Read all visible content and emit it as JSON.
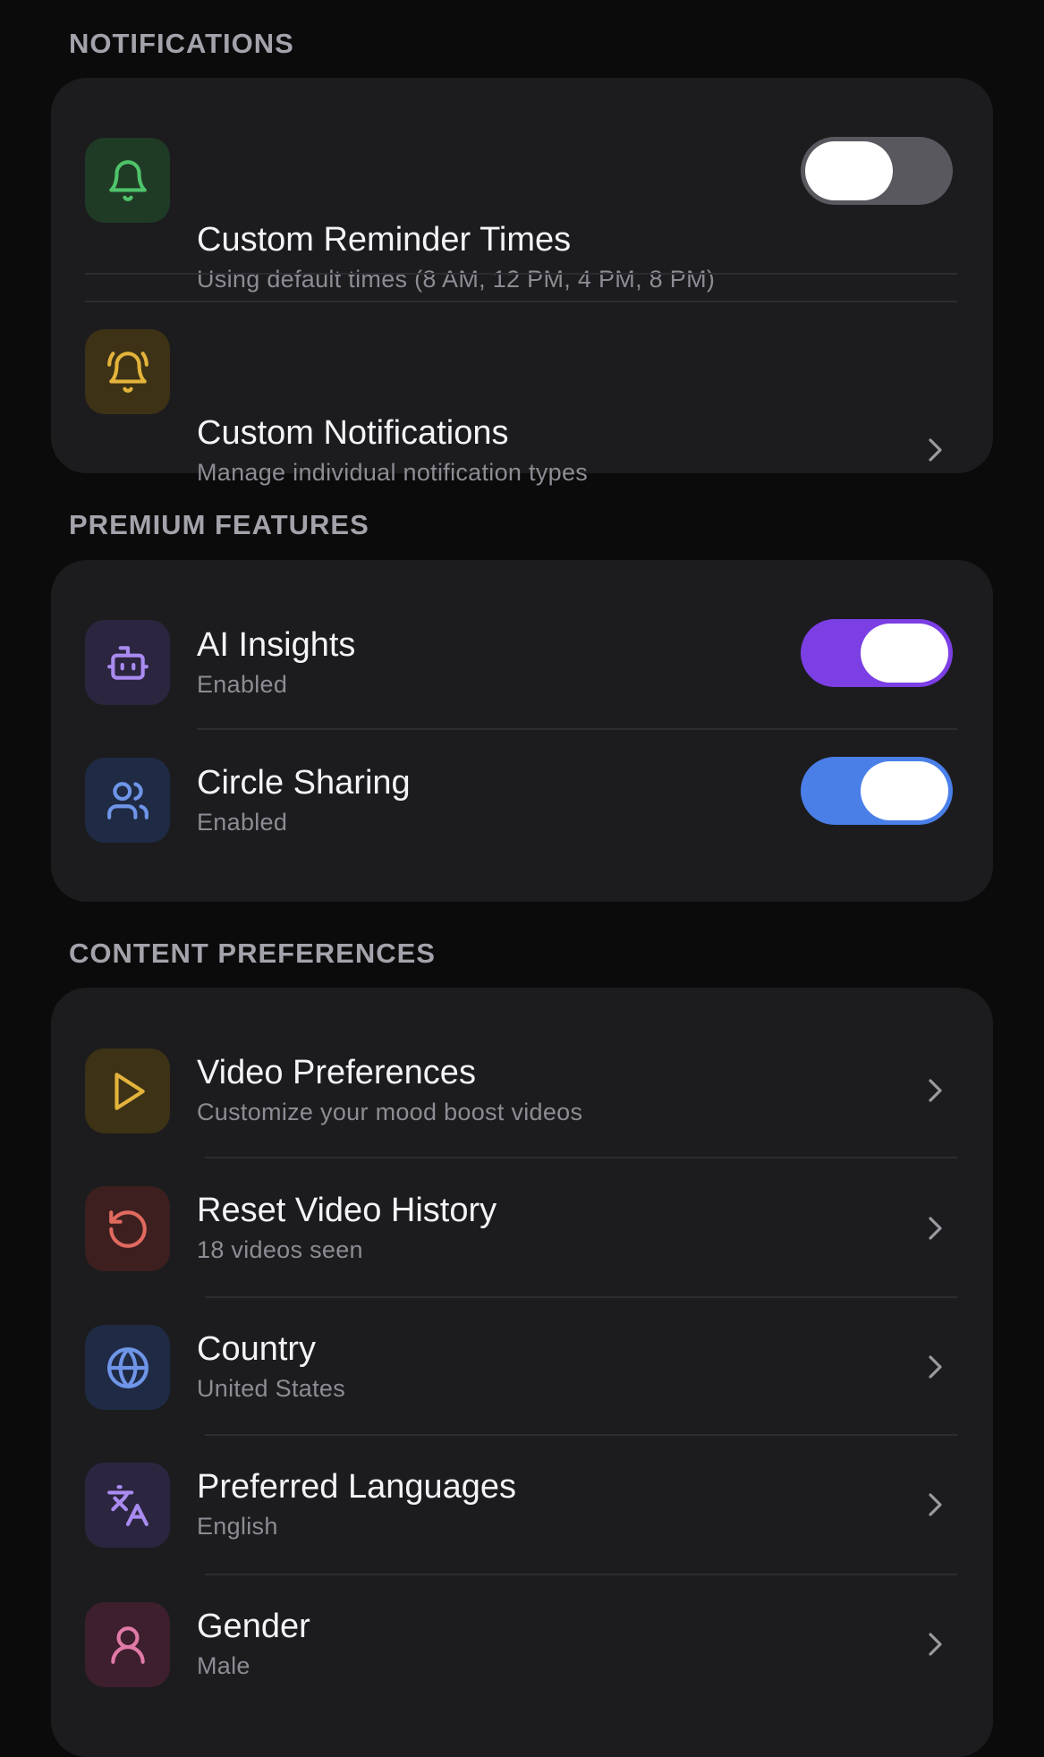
{
  "sections": {
    "notifications": {
      "header": "NOTIFICATIONS",
      "custom_reminder": {
        "title": "Custom Reminder Times",
        "subtitle": "Using default times (8 AM, 12 PM, 4 PM, 8 PM)",
        "toggle_on": false,
        "icon": "bell-icon"
      },
      "custom_notifications": {
        "title": "Custom Notifications",
        "subtitle": "Manage individual notification types",
        "icon": "bell-ring-icon"
      }
    },
    "premium": {
      "header": "PREMIUM FEATURES",
      "ai_insights": {
        "title": "AI Insights",
        "subtitle": "Enabled",
        "toggle_on": true,
        "icon": "robot-icon"
      },
      "circle_sharing": {
        "title": "Circle Sharing",
        "subtitle": "Enabled",
        "toggle_on": true,
        "icon": "users-icon"
      }
    },
    "content": {
      "header": "CONTENT PREFERENCES",
      "video_preferences": {
        "title": "Video Preferences",
        "subtitle": "Customize your mood boost videos",
        "icon": "play-icon"
      },
      "reset_history": {
        "title": "Reset Video History",
        "subtitle": "18 videos seen",
        "icon": "rotate-ccw-icon"
      },
      "country": {
        "title": "Country",
        "subtitle": "United States",
        "icon": "globe-icon"
      },
      "languages": {
        "title": "Preferred Languages",
        "subtitle": "English",
        "icon": "translate-icon"
      },
      "gender": {
        "title": "Gender",
        "subtitle": "Male",
        "icon": "user-icon"
      }
    }
  },
  "colors": {
    "background": "#0b0b0c",
    "card": "#1c1c1e",
    "header_text": "#a3a3ab",
    "toggle_purple": "#7b3fe4",
    "toggle_blue": "#4a7fe8",
    "toggle_off": "#58585e",
    "green_icon": "#4fc36a",
    "yellow_icon": "#e3b33b",
    "purple_icon": "#a98bf0",
    "blue_icon": "#6f95e8",
    "red_icon": "#e06a5e",
    "pink_icon": "#e07aa6"
  }
}
